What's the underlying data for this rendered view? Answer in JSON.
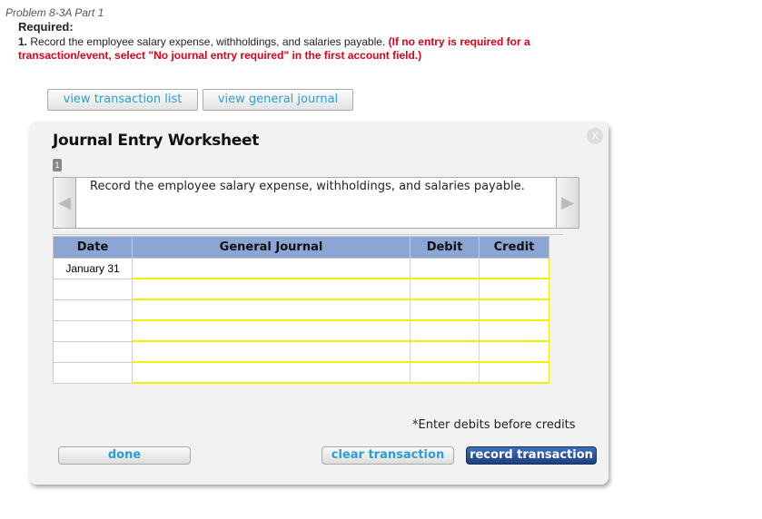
{
  "header": {
    "problem": "Problem 8-3A Part 1",
    "required": "Required:",
    "item_number": "1.",
    "instruction": "Record the employee salary expense, withholdings, and salaries payable.",
    "note": "(If no entry is required for a transaction/event, select \"No journal entry required\" in the first account field.)"
  },
  "toolbar": {
    "view_list": "view transaction list",
    "view_journal": "view general journal"
  },
  "worksheet": {
    "title": "Journal Entry Worksheet",
    "close": "X",
    "page": "1",
    "description": "Record the employee salary expense, withholdings, and salaries payable.",
    "columns": [
      "Date",
      "General Journal",
      "Debit",
      "Credit"
    ],
    "rows": [
      {
        "date": "January 31"
      },
      {
        "date": ""
      },
      {
        "date": ""
      },
      {
        "date": ""
      },
      {
        "date": ""
      },
      {
        "date": ""
      }
    ],
    "hint": "*Enter debits before credits",
    "done": "done",
    "clear": "clear transaction",
    "record": "record transaction"
  }
}
